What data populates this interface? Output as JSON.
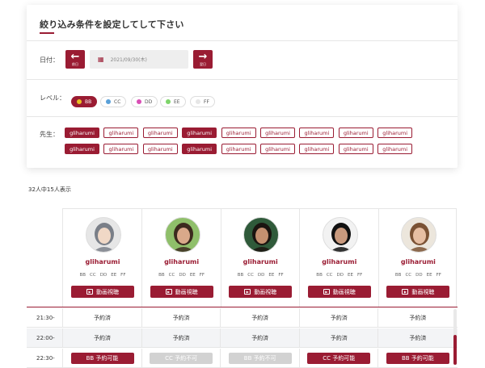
{
  "filter": {
    "title": "絞り込み条件を設定してして下さい",
    "date_label": "日付：",
    "prev_label": "前日",
    "next_label": "翌日",
    "date_value": "2021/09/30(木)",
    "level_label": "レベル：",
    "levels": [
      {
        "label": "BB",
        "color": "#e8c021",
        "active": true
      },
      {
        "label": "CC",
        "color": "#5aa0d8",
        "active": false
      },
      {
        "label": "DD",
        "color": "#d94fb5",
        "active": false
      },
      {
        "label": "EE",
        "color": "#7ed46a",
        "active": false
      },
      {
        "label": "FF",
        "color": "#e6e6e6",
        "active": false
      }
    ],
    "teacher_label": "先生：",
    "teachers_row1": [
      {
        "label": "gliharumi",
        "active": true
      },
      {
        "label": "gliharumi",
        "active": false
      },
      {
        "label": "gliharumi",
        "active": false
      },
      {
        "label": "gliharumi",
        "active": true
      },
      {
        "label": "gliharumi",
        "active": false
      },
      {
        "label": "gliharumi",
        "active": false
      },
      {
        "label": "gliharumi",
        "active": false
      },
      {
        "label": "gliharumi",
        "active": false
      },
      {
        "label": "gliharumi",
        "active": false
      }
    ],
    "teachers_row2": [
      {
        "label": "gliharumi",
        "active": true
      },
      {
        "label": "gliharumi",
        "active": false
      },
      {
        "label": "gliharumi",
        "active": false
      },
      {
        "label": "gliharumi",
        "active": true
      },
      {
        "label": "gliharumi",
        "active": false
      },
      {
        "label": "gliharumi",
        "active": false
      },
      {
        "label": "gliharumi",
        "active": false
      },
      {
        "label": "gliharumi",
        "active": false
      },
      {
        "label": "gliharumi",
        "active": false
      }
    ]
  },
  "result_count": "32人中15人表示",
  "teachers": [
    {
      "name": "gliharumi",
      "levels": [
        "BB",
        "CC",
        "DD",
        "EE",
        "FF"
      ],
      "video_label": "動画視聴",
      "avatar_bg": "#e6e6e6",
      "hair": "#7a7f88",
      "skin": "#f0d8c6"
    },
    {
      "name": "gliharumi",
      "levels": [
        "BB",
        "CC",
        "DD",
        "EE",
        "FF"
      ],
      "video_label": "動画視聴",
      "avatar_bg": "#8fbf6a",
      "hair": "#3c2a1e",
      "skin": "#d9a98a"
    },
    {
      "name": "gliharumi",
      "levels": [
        "BB",
        "CC",
        "DD",
        "EE",
        "FF"
      ],
      "video_label": "動画視聴",
      "avatar_bg": "#2f5a3a",
      "hair": "#1b1410",
      "skin": "#c49070"
    },
    {
      "name": "gliharumi",
      "levels": [
        "BB",
        "CC",
        "DD",
        "EE",
        "FF"
      ],
      "video_label": "動画視聴",
      "avatar_bg": "#f2f2f2",
      "hair": "#111111",
      "skin": "#c99a7e"
    },
    {
      "name": "gliharumi",
      "levels": [
        "BB",
        "CC",
        "DD",
        "EE",
        "FF"
      ],
      "video_label": "動画視聴",
      "avatar_bg": "#ece6dc",
      "hair": "#7b5234",
      "skin": "#e6bea2"
    }
  ],
  "schedule": [
    {
      "time": "21:30-",
      "cells": [
        {
          "text": "予約済",
          "kind": "plain"
        },
        {
          "text": "予約済",
          "kind": "plain"
        },
        {
          "text": "予約済",
          "kind": "plain"
        },
        {
          "text": "予約済",
          "kind": "plain"
        },
        {
          "text": "予約済",
          "kind": "plain"
        }
      ]
    },
    {
      "time": "22:00-",
      "cells": [
        {
          "text": "予約済",
          "kind": "plain"
        },
        {
          "text": "予約済",
          "kind": "plain"
        },
        {
          "text": "予約済",
          "kind": "plain"
        },
        {
          "text": "予約済",
          "kind": "plain"
        },
        {
          "text": "予約済",
          "kind": "plain"
        }
      ]
    },
    {
      "time": "22:30-",
      "cells": [
        {
          "text": "BB 予約可能",
          "kind": "avail"
        },
        {
          "text": "CC 予約不可",
          "kind": "unavail"
        },
        {
          "text": "BB 予約不可",
          "kind": "unavail"
        },
        {
          "text": "CC 予約可能",
          "kind": "avail"
        },
        {
          "text": "BB 予約可能",
          "kind": "avail"
        }
      ]
    }
  ],
  "colors": {
    "accent": "#9a1c33"
  }
}
